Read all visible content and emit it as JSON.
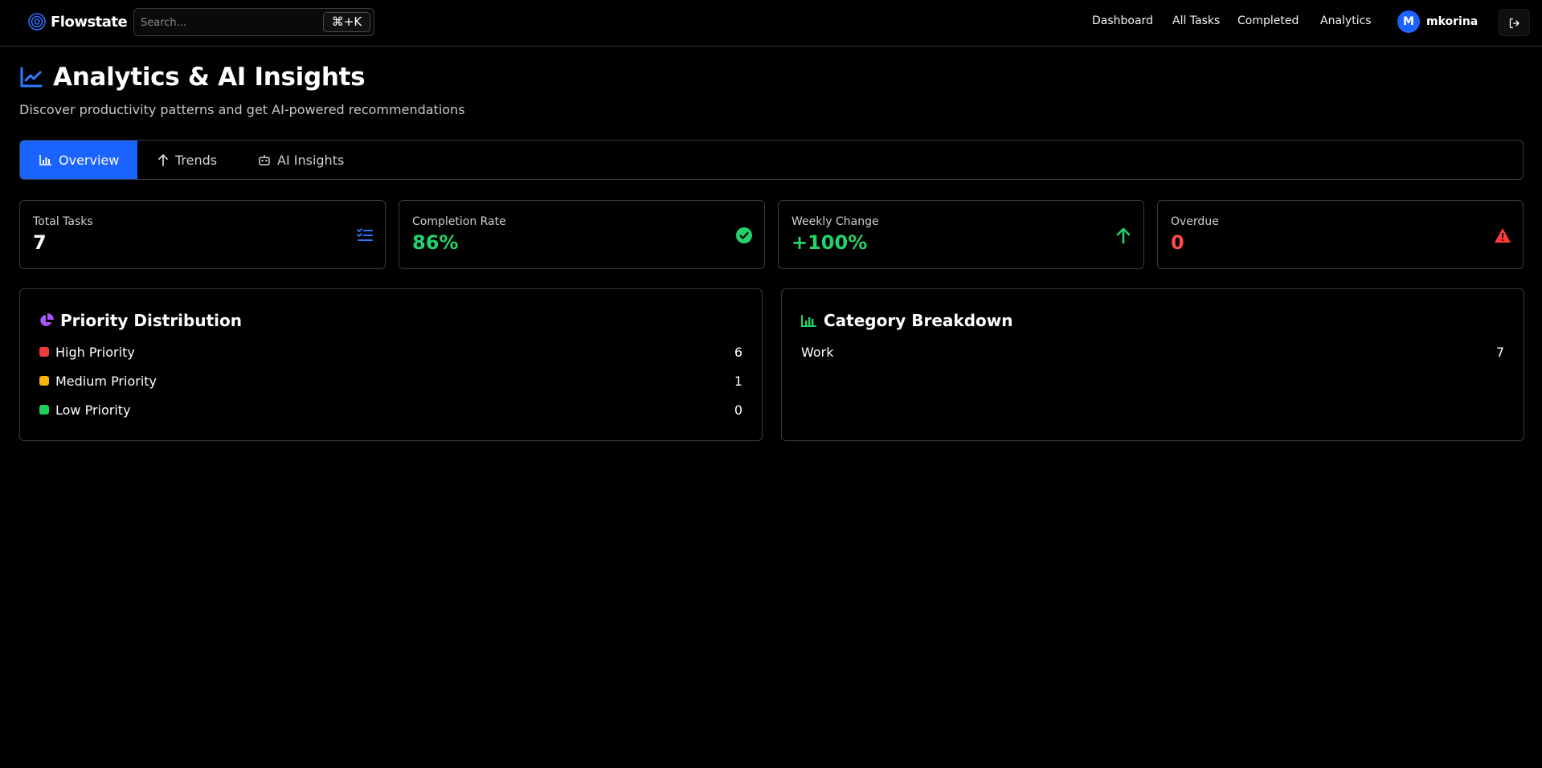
{
  "app": {
    "name": "Flowstate"
  },
  "search": {
    "placeholder": "Search...",
    "shortcut": "⌘+K"
  },
  "nav": {
    "links": [
      "Dashboard",
      "All Tasks",
      "Completed",
      "Analytics"
    ]
  },
  "user": {
    "initial": "M",
    "name": "mkorina",
    "avatar_color": "#1b63ff"
  },
  "page": {
    "title": "Analytics & AI Insights",
    "subtitle": "Discover productivity patterns and get AI-powered recommendations"
  },
  "tabs": [
    {
      "label": "Overview",
      "icon": "bar-chart-icon",
      "active": true
    },
    {
      "label": "Trends",
      "icon": "arrow-up-icon",
      "active": false
    },
    {
      "label": "AI Insights",
      "icon": "robot-icon",
      "active": false
    }
  ],
  "stats": [
    {
      "label": "Total Tasks",
      "value": "7",
      "color": "#ffffff",
      "icon": "list-checks-icon",
      "icon_color": "#2f7bff"
    },
    {
      "label": "Completion Rate",
      "value": "86%",
      "color": "#22d36b",
      "icon": "check-circle-icon",
      "icon_color": "#22d36b"
    },
    {
      "label": "Weekly Change",
      "value": "+100%",
      "color": "#22d36b",
      "icon": "arrow-up-icon",
      "icon_color": "#22d36b"
    },
    {
      "label": "Overdue",
      "value": "0",
      "color": "#ff4b4b",
      "icon": "warning-icon",
      "icon_color": "#ff3b3b"
    }
  ],
  "priority": {
    "title": "Priority Distribution",
    "icon": "pie-chart-icon",
    "items": [
      {
        "label": "High Priority",
        "count": "6",
        "color": "#ef3b3b"
      },
      {
        "label": "Medium Priority",
        "count": "1",
        "color": "#f5b50a"
      },
      {
        "label": "Low Priority",
        "count": "0",
        "color": "#1fcf5e"
      }
    ]
  },
  "category": {
    "title": "Category Breakdown",
    "icon": "bar-chart-icon",
    "items": [
      {
        "label": "Work",
        "count": "7"
      }
    ]
  },
  "colors": {
    "accent": "#1b63ff",
    "success": "#22d36b",
    "danger": "#ff4b4b"
  }
}
